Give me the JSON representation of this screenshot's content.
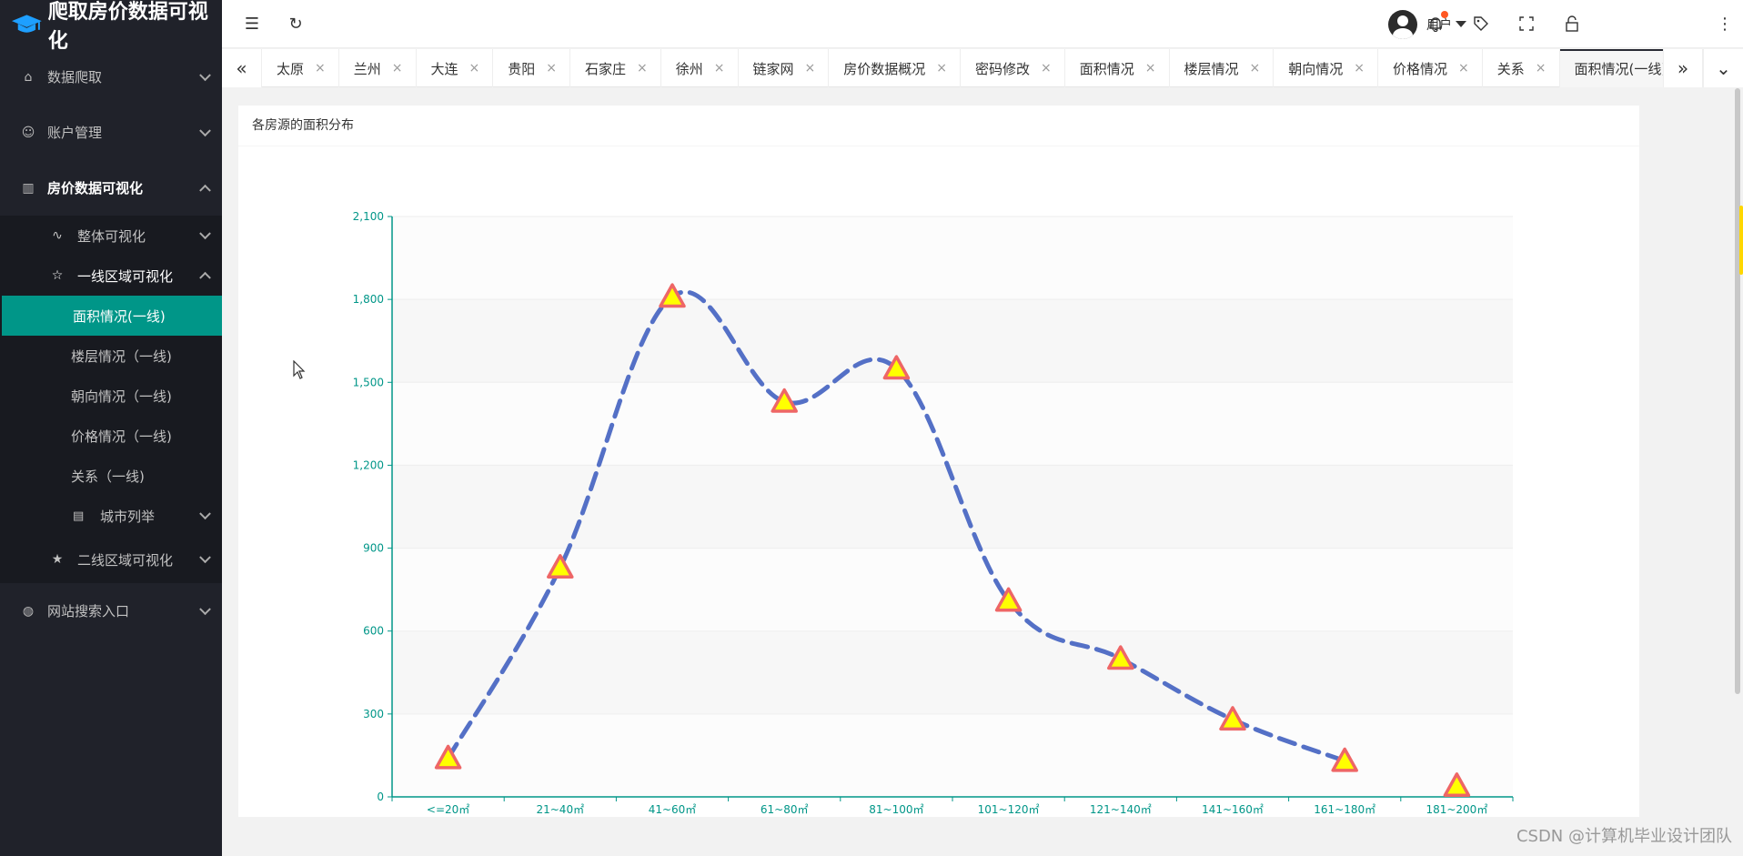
{
  "app": {
    "title": "爬取房价数据可视化"
  },
  "sidebar": {
    "items": [
      {
        "label": "数据爬取"
      },
      {
        "label": "账户管理"
      },
      {
        "label": "房价数据可视化"
      },
      {
        "label": "网站搜索入口"
      }
    ],
    "sub": {
      "overall": "整体可视化",
      "tier1": "一线区域可视化",
      "tier1_items": [
        "面积情况(一线)",
        "楼层情况（一线)",
        "朝向情况（一线)",
        "价格情况（一线)",
        "关系（一线)"
      ],
      "city_list": "城市列举",
      "tier2": "二线区域可视化"
    }
  },
  "header": {
    "user": "用户"
  },
  "tabs": [
    "太原",
    "兰州",
    "大连",
    "贵阳",
    "石家庄",
    "徐州",
    "链家网",
    "房价数据概况",
    "密码修改",
    "面积情况",
    "楼层情况",
    "朝向情况",
    "价格情况",
    "关系",
    "面积情况(一线)"
  ],
  "card": {
    "title": "各房源的面积分布"
  },
  "chart_data": {
    "type": "line",
    "categories": [
      "<=20㎡",
      "21~40㎡",
      "41~60㎡",
      "61~80㎡",
      "81~100㎡",
      "101~120㎡",
      "121~140㎡",
      "141~160㎡",
      "161~180㎡",
      "181~200㎡"
    ],
    "values": [
      140,
      830,
      1810,
      1430,
      1550,
      710,
      500,
      280,
      130,
      40
    ],
    "yticks": [
      0,
      300,
      600,
      900,
      1200,
      1500,
      1800,
      2100
    ],
    "ylim": [
      0,
      2100
    ],
    "line_style": "dashed smooth",
    "marker": "triangle",
    "colors": {
      "line": "#5470c6",
      "marker_fill": "#ffff00",
      "marker_stroke": "#ee6666",
      "axis": "#009688"
    }
  },
  "watermark": "CSDN @计算机毕业设计团队"
}
